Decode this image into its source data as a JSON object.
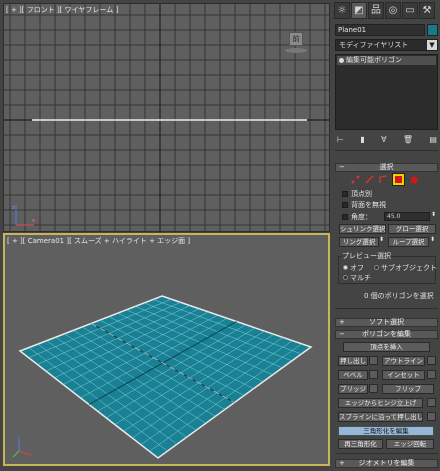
{
  "viewports": {
    "front_label": "[ + ][ フロント ][ ワイヤフレーム ]",
    "camera_label": "[ + ][ Camera01 ][ スムーズ + ハイライト + エッジ面 ]",
    "front_view_badge": "前"
  },
  "command_panel": {
    "tabs": [
      {
        "icon": "sun-icon",
        "glyph": "☼"
      },
      {
        "icon": "modify-icon",
        "glyph": "◩"
      },
      {
        "icon": "hierarchy-icon",
        "glyph": "品"
      },
      {
        "icon": "motion-icon",
        "glyph": "◎"
      },
      {
        "icon": "display-icon",
        "glyph": "▭"
      },
      {
        "icon": "utilities-icon",
        "glyph": "⚒"
      }
    ],
    "object_name": "Plane01",
    "object_color": "#157b87",
    "modifier_list": "モディファイヤリスト",
    "stack_item": "編集可能ポリゴン",
    "selection": {
      "header": "選択",
      "by_vertex": "頂点別",
      "ignore_backfacing": "背面を無視",
      "angle_label": "角度：",
      "angle_value": "45.0",
      "shrink": "シュリンク選択",
      "grow": "グロー選択",
      "ring": "リング選択",
      "loop": "ループ選択",
      "preview_header": "プレビュー選択",
      "off": "オフ",
      "subobject": "サブオブジェクト",
      "multi": "マルチ",
      "status": "0 個のポリゴンを選択"
    },
    "soft_selection": {
      "header": "ソフト選択"
    },
    "edit_polygons": {
      "header": "ポリゴンを編集",
      "insert_vertex": "頂点を挿入",
      "extrude": "押し出し",
      "outline": "アウトライン",
      "bevel": "ベベル",
      "inset": "インセット",
      "bridge": "ブリッジ",
      "flip": "フリップ",
      "hinge": "エッジからヒンジ立上げ",
      "extrude_along_spline": "スプラインに沿って押し出し",
      "edit_triangulation": "三角形化を編集",
      "retriangulate": "再三角形化",
      "turn": "エッジ回転"
    },
    "edit_geometry": {
      "header": "ジオメトリを編集"
    }
  }
}
